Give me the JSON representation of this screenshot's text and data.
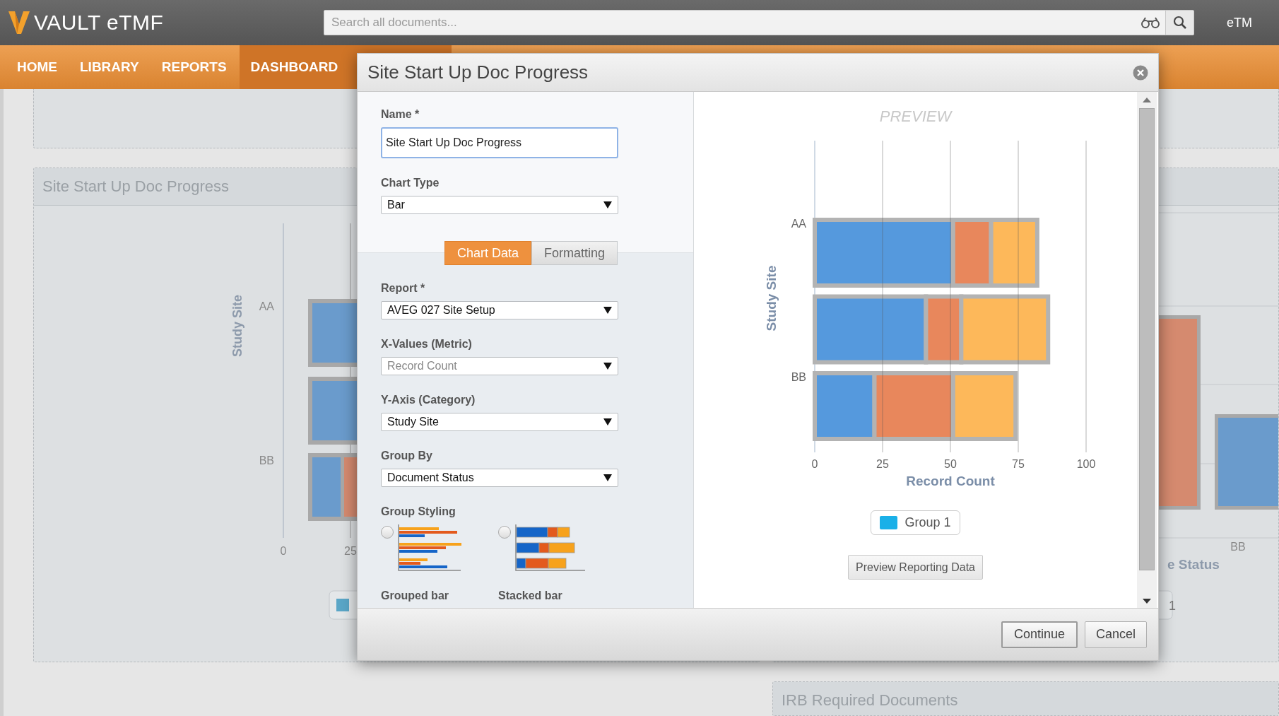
{
  "app_bar": {
    "logo": "VAULT eTMF",
    "search": {
      "placeholder": "Search all documents..."
    },
    "user_menu": "eTM"
  },
  "nav": [
    {
      "label": "HOME",
      "selected": false
    },
    {
      "label": "LIBRARY",
      "selected": false
    },
    {
      "label": "REPORTS",
      "selected": false
    },
    {
      "label": "DASHBOARD",
      "selected": true
    }
  ],
  "dashboard": {
    "chart_panel": {
      "title": "Site Start Up Doc Progress",
      "ylabel": "Study Site",
      "category_labels": [
        "AA",
        "BB"
      ],
      "tick_labels": [
        "0",
        "25"
      ]
    },
    "status_panel": {
      "xlabel": "e Status",
      "category_label": "BB",
      "legend_text": "1"
    },
    "irb_panel": {
      "title": "IRB Required Documents"
    }
  },
  "dialog": {
    "title": "Site Start Up Doc Progress",
    "name_field": {
      "label": "Name *",
      "value": "Site Start Up Doc Progress"
    },
    "chart_type": {
      "label": "Chart Type",
      "value": "Bar"
    },
    "tabs": [
      {
        "label": "Chart Data",
        "selected": true
      },
      {
        "label": "Formatting",
        "selected": false
      }
    ],
    "fields": [
      {
        "label": "Report *",
        "value": "AVEG 027 Site Setup",
        "disabled": false
      },
      {
        "label": "X-Values (Metric)",
        "value": "Record Count",
        "disabled": true
      },
      {
        "label": "Y-Axis (Category)",
        "value": "Study Site",
        "disabled": false
      },
      {
        "label": "Group By",
        "value": "Document Status",
        "disabled": false
      }
    ],
    "group_styling": {
      "label": "Group Styling",
      "options": [
        {
          "label": "Grouped bar",
          "kind": "grouped",
          "selected": false
        },
        {
          "label": "Stacked bar",
          "kind": "stacked",
          "selected": false
        }
      ]
    },
    "preview": {
      "label": "PREVIEW",
      "chart_data": {
        "type": "bar",
        "orientation": "horizontal",
        "stacked": true,
        "grid": true,
        "categories": [
          "AA",
          null,
          "BB"
        ],
        "xlabel": "Record Count",
        "ylabel": "Study Site",
        "xlim": [
          0,
          100
        ],
        "xticks": [
          0,
          25,
          50,
          75,
          100
        ],
        "series": [
          {
            "color": "#5599dd",
            "values": [
              51,
              41,
              22
            ]
          },
          {
            "color": "#e8875c",
            "values": [
              14,
              13,
              29
            ]
          },
          {
            "color": "#fdb85a",
            "values": [
              17,
              32,
              23
            ]
          }
        ]
      },
      "legend": [
        {
          "label": "Group 1",
          "color": "#1ab0e8"
        }
      ],
      "button": "Preview Reporting Data"
    },
    "buttons": [
      "Continue",
      "Cancel"
    ]
  }
}
